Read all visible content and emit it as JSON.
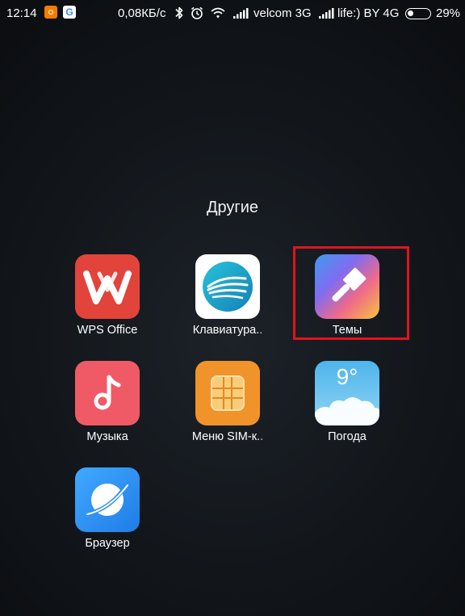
{
  "status_bar": {
    "time": "12:14",
    "google_badge": "G",
    "data_speed": "0,08КБ/с",
    "carrier1": "velcom 3G",
    "carrier2": "life:) BY 4G",
    "battery_percent": "29%",
    "battery_level": 0.29,
    "icons": [
      "mi-notification-icon",
      "google-notification-icon",
      "bluetooth-icon",
      "alarm-icon",
      "wifi-icon",
      "signal-icon",
      "signal-icon",
      "battery-icon"
    ]
  },
  "folder": {
    "title": "Другие"
  },
  "apps": [
    {
      "label": "WPS Office",
      "icon": "wps-office-icon",
      "color": "#e2433b"
    },
    {
      "label": "Клавиатура..",
      "icon": "swiftkey-icon",
      "color": "#1aa5c6"
    },
    {
      "label": "Темы",
      "icon": "themes-brush-icon",
      "color": "#7b6cf2"
    },
    {
      "label": "Музыка",
      "icon": "music-note-icon",
      "color": "#f05a66"
    },
    {
      "label": "Меню SIM-к..",
      "icon": "sim-card-icon",
      "color": "#f0932b"
    },
    {
      "label": "Погода",
      "icon": "weather-icon",
      "color": "#6ec8f0"
    },
    {
      "label": "Браузер",
      "icon": "browser-globe-icon",
      "color": "#2d8ff0"
    }
  ],
  "weather_temp": "9°",
  "highlight": {
    "color": "#e0141e",
    "target": "Темы"
  }
}
